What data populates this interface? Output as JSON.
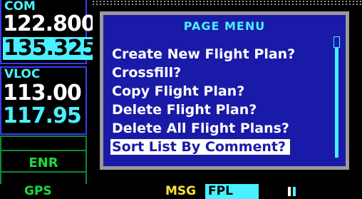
{
  "com": {
    "label": "COM",
    "active": "122.800",
    "standby": "135.325"
  },
  "vloc": {
    "label": "VLOC",
    "active": "113.00",
    "standby": "117.95"
  },
  "mode": {
    "enr": "ENR"
  },
  "menu": {
    "title": "PAGE MENU",
    "items": [
      "Create New Flight Plan?",
      "Crossfill?",
      "Copy Flight Plan?",
      "Delete Flight Plan?",
      "Delete All Flight Plans?",
      "Sort List By Comment?"
    ],
    "selected_index": 5
  },
  "status_bar": {
    "gps": "GPS",
    "msg": "MSG",
    "page_group": "FPL",
    "page_count": 2,
    "current_page": 1
  },
  "colors": {
    "cyan": "#49f0ff",
    "menu_bg": "#1a1aa8",
    "green": "#20d840",
    "yellow": "#ffe233"
  }
}
